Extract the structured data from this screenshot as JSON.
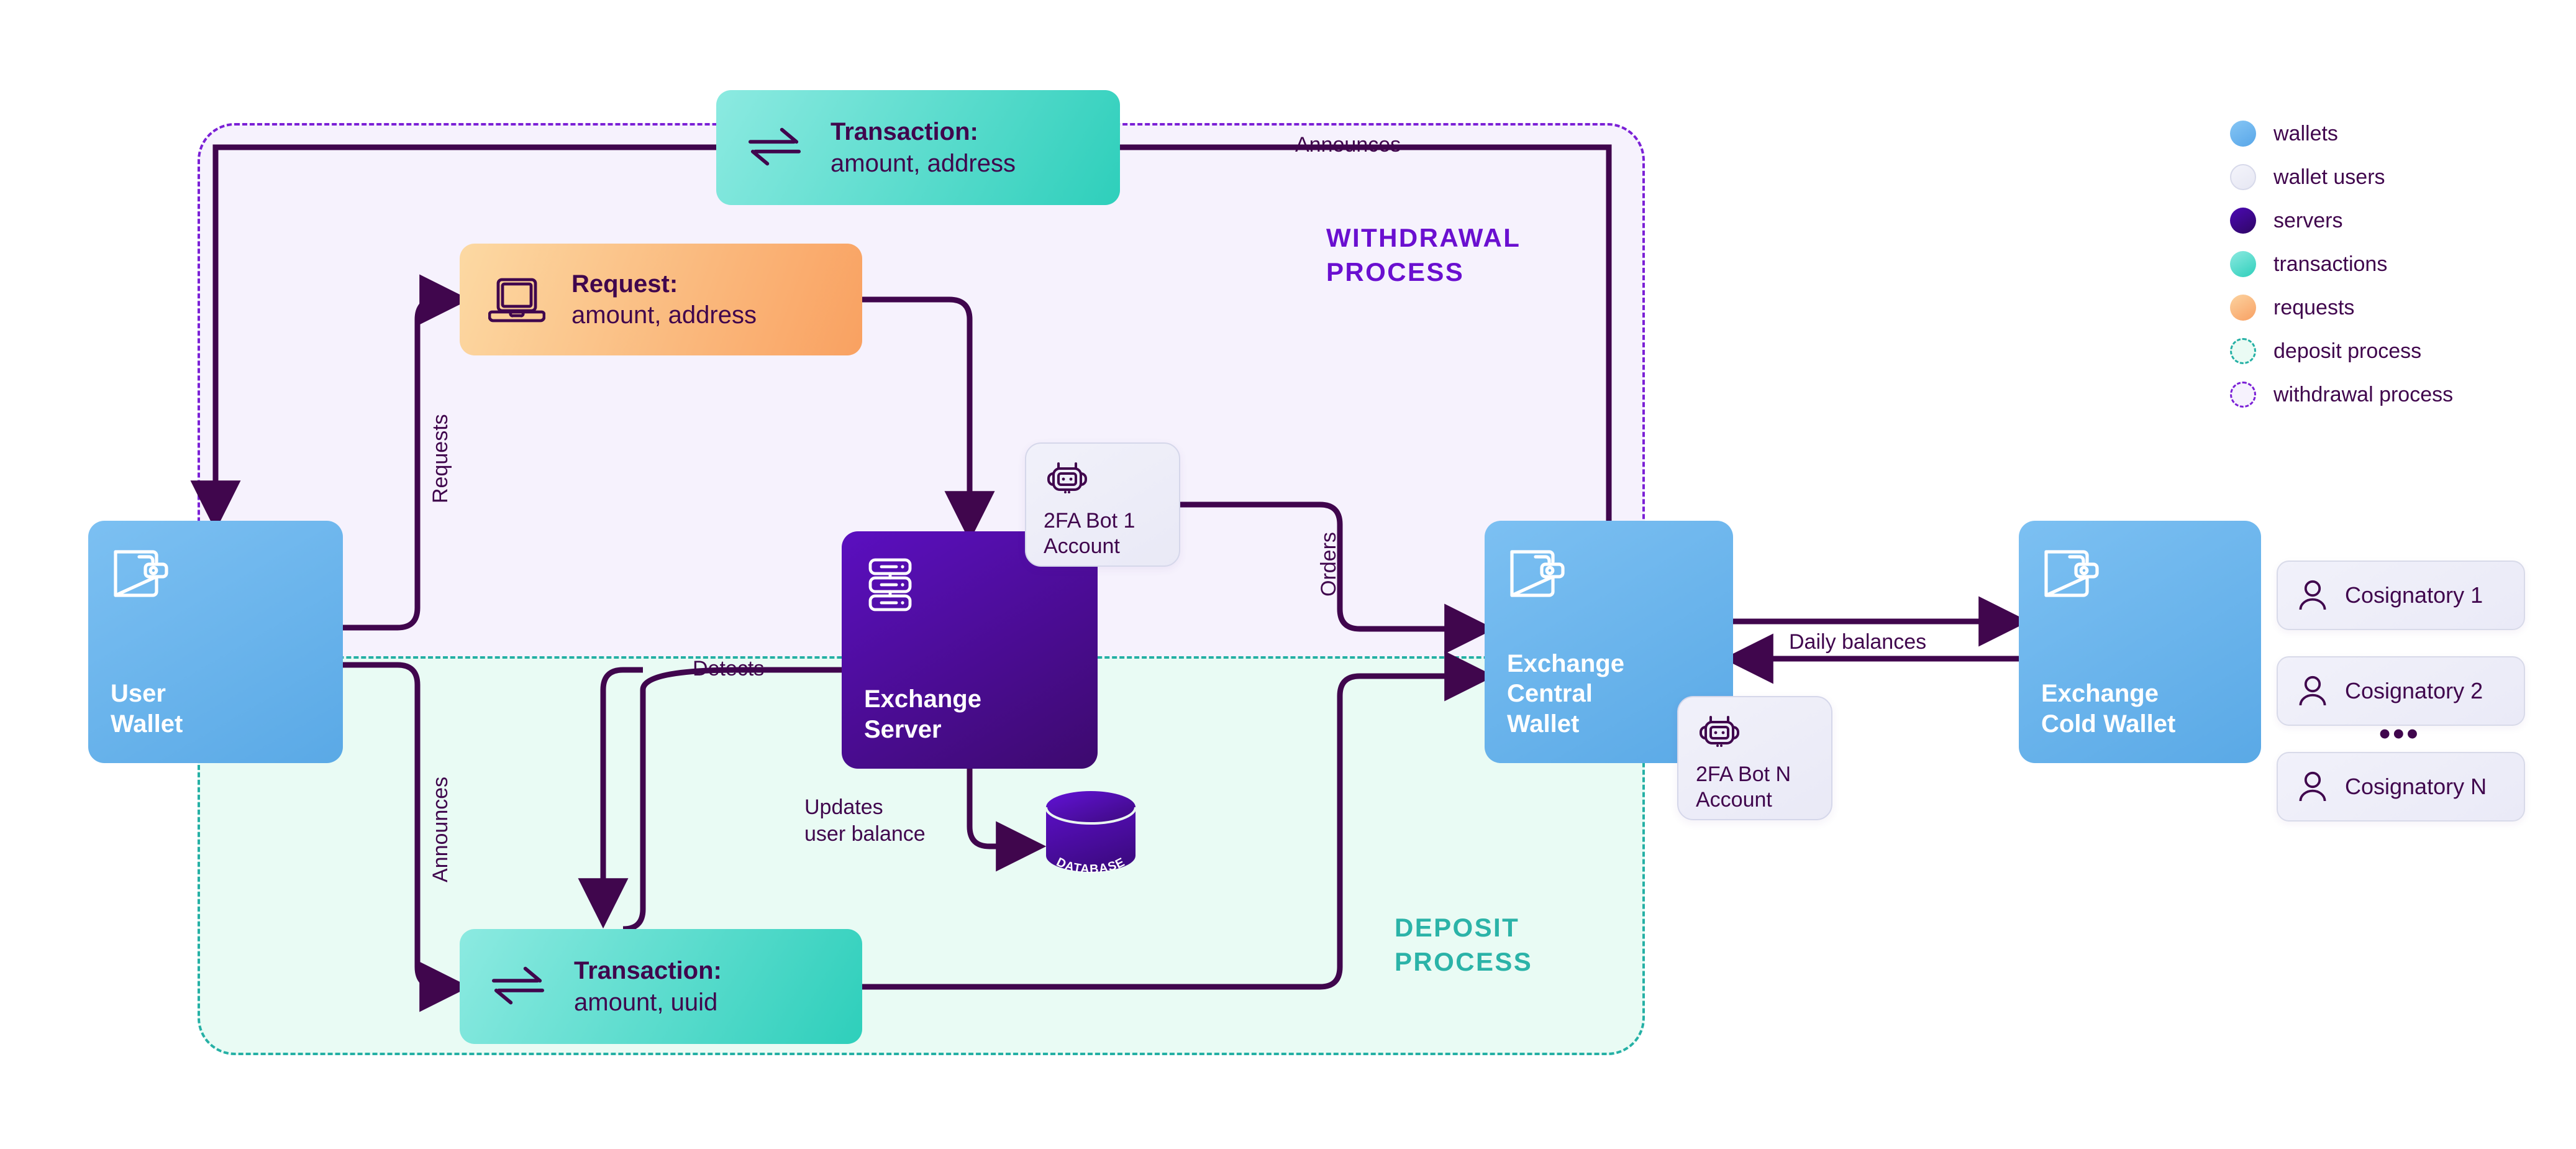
{
  "regions": {
    "withdrawal": {
      "title": "WITHDRAWAL\nPROCESS",
      "color": "#6a0fd0",
      "fill": "#f6f2fd"
    },
    "deposit": {
      "title": "DEPOSIT\nPROCESS",
      "color": "#2bb3a8",
      "fill": "#e9fbf4"
    }
  },
  "nodes": {
    "user_wallet": {
      "label": "User\nWallet",
      "icon": "wallet-icon"
    },
    "exchange_server": {
      "label": "Exchange\nServer",
      "icon": "server-rack-icon"
    },
    "central_wallet": {
      "label": "Exchange\nCentral\nWallet",
      "icon": "wallet-icon"
    },
    "cold_wallet": {
      "label": "Exchange\nCold Wallet",
      "icon": "wallet-icon"
    },
    "tx_withdraw": {
      "title": "Transaction:",
      "subtitle": "amount, address",
      "icon": "exchange-arrows-icon"
    },
    "tx_deposit": {
      "title": "Transaction:",
      "subtitle": "amount, uuid",
      "icon": "exchange-arrows-icon"
    },
    "request": {
      "title": "Request:",
      "subtitle": "amount, address",
      "icon": "laptop-icon"
    },
    "bot1": {
      "label": "2FA Bot 1\nAccount",
      "icon": "robot-icon"
    },
    "botN": {
      "label": "2FA Bot N\nAccount",
      "icon": "robot-icon"
    },
    "database": {
      "label": "DATABASE",
      "icon": "database-cylinder-icon"
    }
  },
  "cosignatories": [
    {
      "label": "Cosignatory 1"
    },
    {
      "label": "Cosignatory 2"
    },
    {
      "label": "Cosignatory N"
    }
  ],
  "cosignatory_ellipsis": "•••",
  "edges": {
    "announces_top": "Announces",
    "requests": "Requests",
    "announces_left": "Announces",
    "detects": "Detects",
    "updates_user_balance": "Updates\nuser balance",
    "orders": "Orders",
    "daily_balances": "Daily balances"
  },
  "legend": [
    {
      "label": "wallets",
      "swatch": "wallets",
      "color": "#6bb5ef"
    },
    {
      "label": "wallet users",
      "swatch": "wallet-users",
      "color": "#eceef8"
    },
    {
      "label": "servers",
      "swatch": "servers",
      "color": "#3c078c"
    },
    {
      "label": "transactions",
      "swatch": "transactions",
      "color": "#4ed9c6"
    },
    {
      "label": "requests",
      "swatch": "requests",
      "color": "#f9ae73"
    },
    {
      "label": "deposit process",
      "swatch": "deposit",
      "color": "#25b0a5"
    },
    {
      "label": "withdrawal process",
      "swatch": "withdrawal",
      "color": "#7b20d6"
    }
  ],
  "colors": {
    "line": "#40064d",
    "purple_accent": "#6a0fd0",
    "teal_accent": "#2bb3a8",
    "wallet_blue": "#5aa9e6",
    "server_purple": "#4a0ca0"
  }
}
